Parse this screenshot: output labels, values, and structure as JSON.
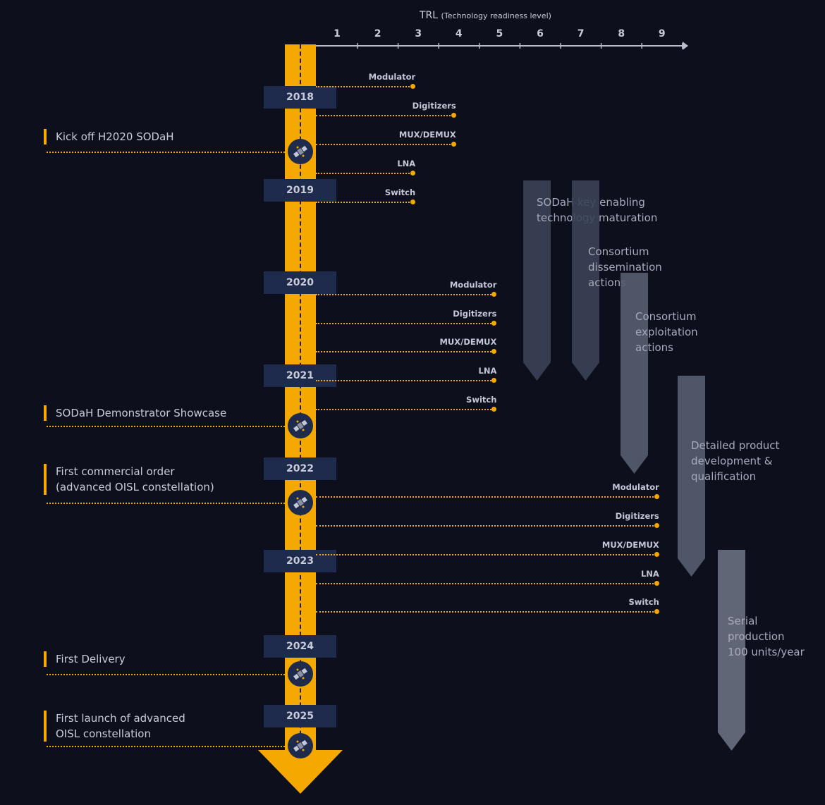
{
  "axis": {
    "title": "TRL",
    "subtitle": "(Technology readiness level)",
    "ticks": [
      "1",
      "2",
      "3",
      "4",
      "5",
      "6",
      "7",
      "8",
      "9"
    ]
  },
  "colors": {
    "background": "#0d101c",
    "accent": "#f5a800",
    "year_box": "#1f2b4d",
    "text": "#c8ccd9"
  },
  "years": [
    "2018",
    "2019",
    "2020",
    "2021",
    "2022",
    "2023",
    "2024",
    "2025"
  ],
  "events": [
    {
      "lines": [
        "Kick off H2020 SODaH"
      ]
    },
    {
      "lines": [
        "SODaH Demonstrator Showcase"
      ]
    },
    {
      "lines": [
        "First commercial order",
        "(advanced OISL constellation)"
      ]
    },
    {
      "lines": [
        "First Delivery"
      ]
    },
    {
      "lines": [
        "First launch of advanced",
        "OISL constellation"
      ]
    }
  ],
  "tech_groups": [
    {
      "items": [
        {
          "label": "Modulator",
          "trl": 3
        },
        {
          "label": "Digitizers",
          "trl": 4
        },
        {
          "label": "MUX/DEMUX",
          "trl": 4
        },
        {
          "label": "LNA",
          "trl": 3
        },
        {
          "label": "Switch",
          "trl": 3
        }
      ]
    },
    {
      "items": [
        {
          "label": "Modulator",
          "trl": 5
        },
        {
          "label": "Digitizers",
          "trl": 5
        },
        {
          "label": "MUX/DEMUX",
          "trl": 5
        },
        {
          "label": "LNA",
          "trl": 5
        },
        {
          "label": "Switch",
          "trl": 5
        }
      ]
    },
    {
      "items": [
        {
          "label": "Modulator",
          "trl": 9
        },
        {
          "label": "Digitizers",
          "trl": 9
        },
        {
          "label": "MUX/DEMUX",
          "trl": 9
        },
        {
          "label": "LNA",
          "trl": 9
        },
        {
          "label": "Switch",
          "trl": 9
        }
      ]
    }
  ],
  "phases": [
    {
      "lines": [
        "SODaH key enabling",
        "technology maturation"
      ]
    },
    {
      "lines": [
        "Consortium",
        "dissemination",
        "actions"
      ]
    },
    {
      "lines": [
        "Consortium",
        "exploitation",
        "actions"
      ]
    },
    {
      "lines": [
        "Detailed product",
        "development &",
        "qualification"
      ]
    },
    {
      "lines": [
        "Serial",
        "production",
        "100 units/year"
      ]
    }
  ],
  "icons": {
    "milestone": "satellite-icon",
    "axis": "arrow-right-icon"
  }
}
